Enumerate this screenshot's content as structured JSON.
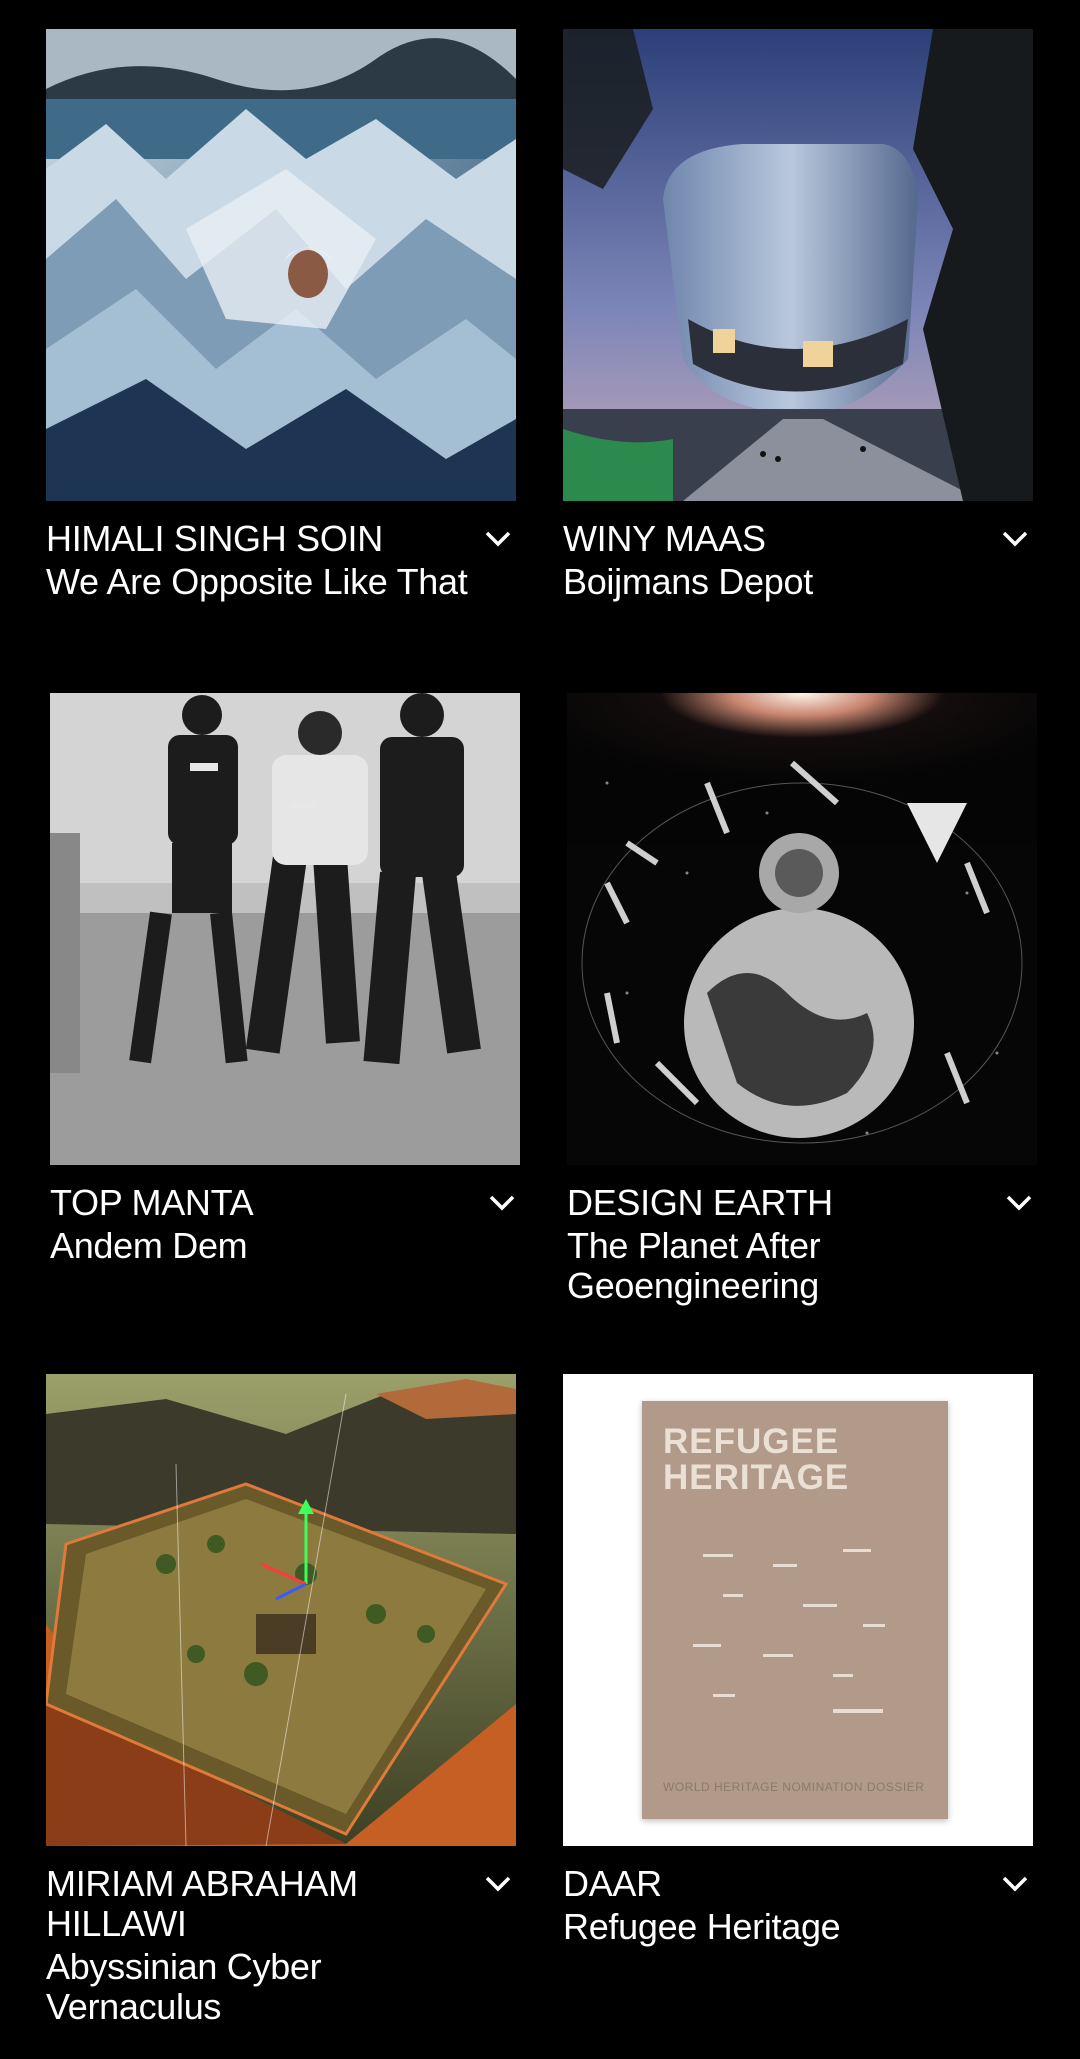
{
  "cards": [
    {
      "artist": "HIMALI SINGH SOIN",
      "work": "We Are Opposite Like That",
      "image": "foil-landscape-portrait",
      "toggle_icon": "chevron-down-icon"
    },
    {
      "artist": "WINY MAAS",
      "work": "Boijmans Depot",
      "image": "mirrored-bowl-building-dusk",
      "toggle_icon": "chevron-down-icon"
    },
    {
      "artist": "TOP MANTA",
      "work": "Andem Dem",
      "image": "runners-black-and-white",
      "toggle_icon": "chevron-down-icon"
    },
    {
      "artist": "DESIGN EARTH",
      "work": "The Planet After Geoengineering",
      "image": "planet-satellites-collage",
      "toggle_icon": "chevron-down-icon"
    },
    {
      "artist": "MIRIAM ABRAHAM HILLAWI",
      "work": "Abyssinian Cyber Vernaculus",
      "image": "3d-terrain-model",
      "toggle_icon": "chevron-down-icon"
    },
    {
      "artist": "DAAR",
      "work": "Refugee Heritage",
      "image": "book-cover",
      "book": {
        "title_line1": "REFUGEE",
        "title_line2": "HERITAGE",
        "footer": "WORLD HERITAGE NOMINATION DOSSIER"
      },
      "toggle_icon": "chevron-down-icon"
    }
  ],
  "colors": {
    "background": "#000000",
    "text": "#ffffff",
    "book_cover": "#b19a89"
  }
}
